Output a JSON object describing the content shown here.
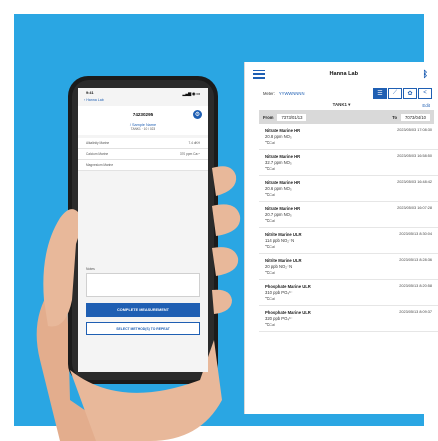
{
  "tablet": {
    "title": "Hanna Lab",
    "meter_label": "Meter:",
    "meter_value": "YYWWNNNN",
    "tank": "TANK1",
    "edit": "Edit",
    "from_label": "From",
    "from_value": "7373/01/13",
    "to_label": "To",
    "to_value": "7073/04/10",
    "logs": [
      {
        "name": "Nitrate Marine HR",
        "value": "20.8 ppm NO₃",
        "temp": "℃Cal",
        "time": "2023/05/03 17:08:30"
      },
      {
        "name": "Nitrate Marine HR",
        "value": "32.7 ppm NO₃",
        "temp": "℃Cal",
        "time": "2023/05/03 16:58:50"
      },
      {
        "name": "Nitrate Marine HR",
        "value": "20.6 ppm NO₃",
        "temp": "℃Cal",
        "time": "2023/05/03 16:48:42"
      },
      {
        "name": "Nitrate Marine HR",
        "value": "20.7 ppm NO₃",
        "temp": "℃Cal",
        "time": "2023/05/03 16:07:28"
      },
      {
        "name": "Nitrite Marine ULR",
        "value": "114 ppb NO₂⁻N",
        "temp": "℃Cal",
        "time": "2023/05/13 8:30:04"
      },
      {
        "name": "Nitrite Marine ULR",
        "value": "20 ppb NO₂⁻N",
        "temp": "℃Cal",
        "time": "2023/05/13 8:28:36"
      },
      {
        "name": "Phosphate Marine ULR",
        "value": "310 ppb PO₄³⁻",
        "temp": "℃Cal",
        "time": "2023/05/13 8:20:58"
      },
      {
        "name": "Phosphate Marine ULR",
        "value": "320 ppb PO₄³⁻",
        "temp": "℃Cal",
        "time": "2023/05/13 8:09:37"
      }
    ]
  },
  "phone": {
    "status_time": "9:41",
    "status_icons": "▂▄▆ ◉ ▭",
    "back_label": "‹ Hanna Lab",
    "code": "74230295",
    "sample_name": "/ Sample Name",
    "sample_sub": "TANK1 · 10 / 023",
    "rows": [
      {
        "label": "Alkalinity Marine",
        "value": "7.4 dKH"
      },
      {
        "label": "Calcium Marine",
        "value": "370 ppm Ca²⁺"
      },
      {
        "label": "Magnesium Marine",
        "value": ""
      }
    ],
    "notes_label": "Notes",
    "primary_button": "COMPLETE MEASUREMENT",
    "secondary_button": "SELECT METHOD(S) TO REPEAT"
  },
  "colors": {
    "frame": "#2aa6e3",
    "accent": "#1f5fb3",
    "skin": "#e8b89a"
  }
}
